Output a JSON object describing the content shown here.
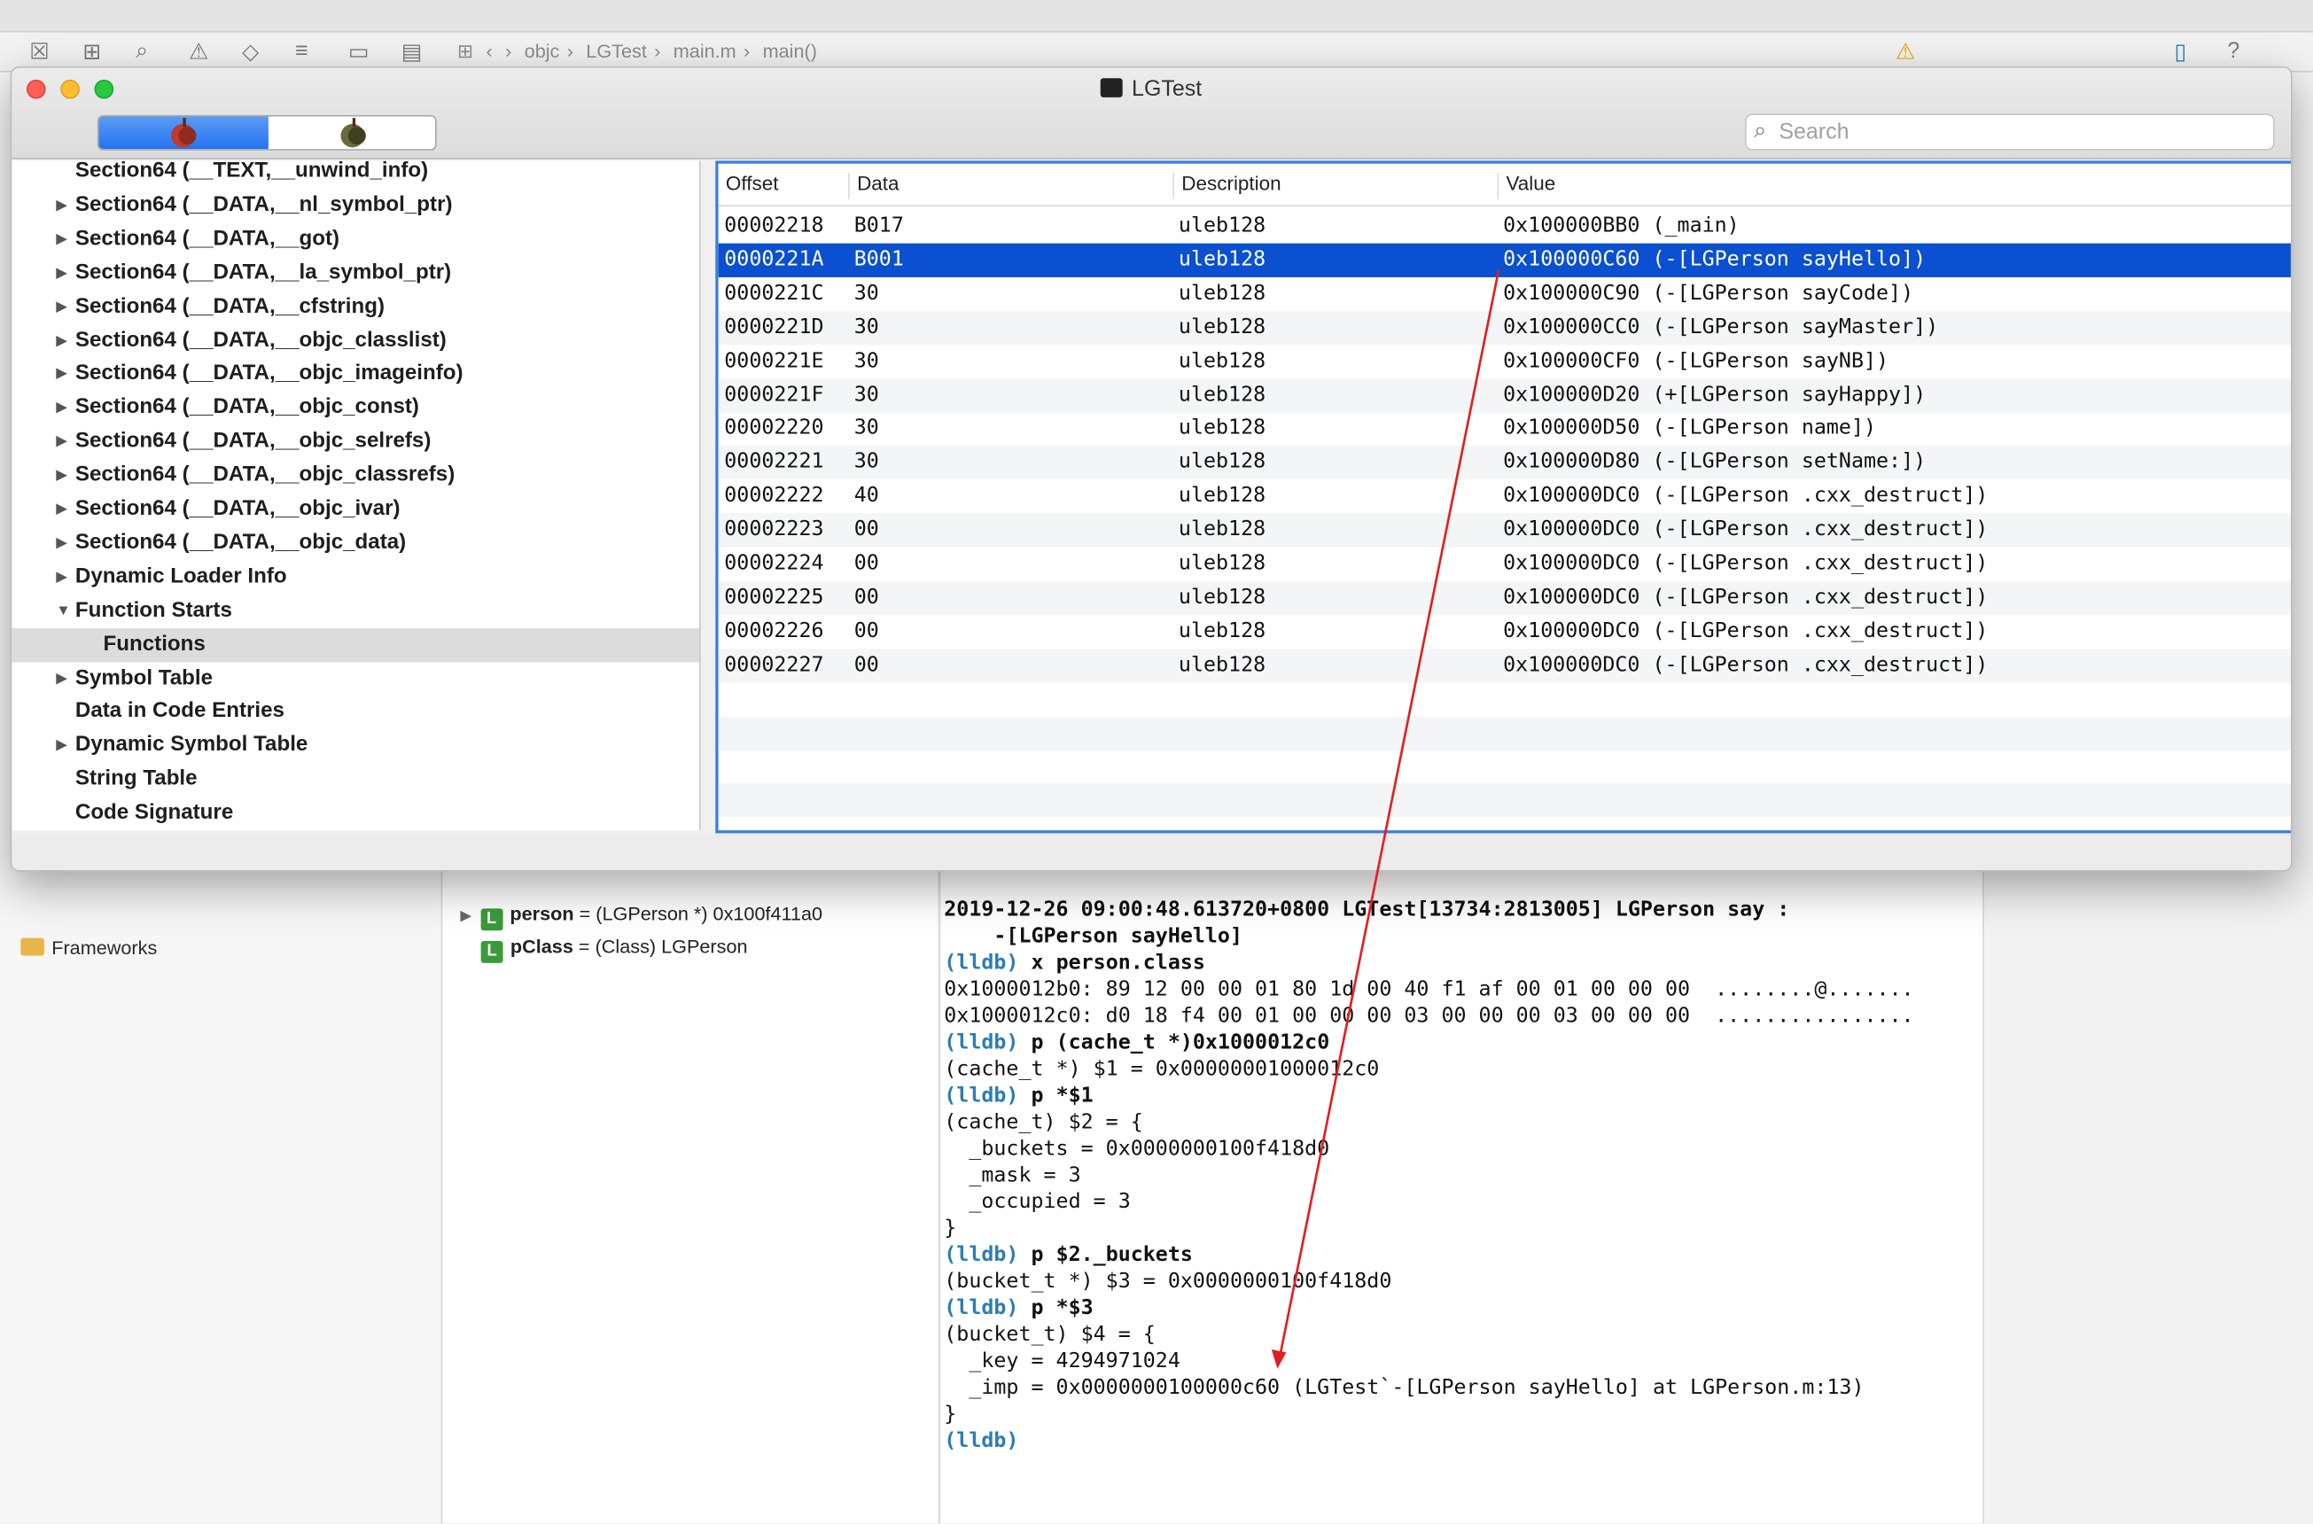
{
  "xcode": {
    "breadcrumb": [
      "objc",
      "LGTest",
      "main.m",
      "main()"
    ],
    "sidebar_item": "Frameworks",
    "variables": [
      {
        "name": "person",
        "value": "= (LGPerson *) 0x100f411a0"
      },
      {
        "name": "pClass",
        "value": "= (Class) LGPerson"
      }
    ],
    "console": [
      {
        "t": "bold",
        "s": "2019-12-26 09:00:48.613720+0800 LGTest[13734:2813005] LGPerson say :"
      },
      {
        "t": "bold",
        "s": "    -[LGPerson sayHello]"
      },
      {
        "t": "cmd",
        "p": "(lldb) ",
        "s": "x person.class"
      },
      {
        "t": "out",
        "s": "0x1000012b0: 89 12 00 00 01 80 1d 00 40 f1 af 00 01 00 00 00  ........@......."
      },
      {
        "t": "out",
        "s": "0x1000012c0: d0 18 f4 00 01 00 00 00 03 00 00 00 03 00 00 00  ................"
      },
      {
        "t": "cmd",
        "p": "(lldb) ",
        "s": "p (cache_t *)0x1000012c0"
      },
      {
        "t": "out",
        "s": "(cache_t *) $1 = 0x00000001000012c0"
      },
      {
        "t": "cmd",
        "p": "(lldb) ",
        "s": "p *$1"
      },
      {
        "t": "out",
        "s": "(cache_t) $2 = {"
      },
      {
        "t": "out",
        "s": "  _buckets = 0x0000000100f418d0"
      },
      {
        "t": "out",
        "s": "  _mask = 3"
      },
      {
        "t": "out",
        "s": "  _occupied = 3"
      },
      {
        "t": "out",
        "s": "}"
      },
      {
        "t": "cmd",
        "p": "(lldb) ",
        "s": "p $2._buckets"
      },
      {
        "t": "out",
        "s": "(bucket_t *) $3 = 0x0000000100f418d0"
      },
      {
        "t": "cmd",
        "p": "(lldb) ",
        "s": "p *$3"
      },
      {
        "t": "out",
        "s": "(bucket_t) $4 = {"
      },
      {
        "t": "out",
        "s": "  _key = 4294971024"
      },
      {
        "t": "out",
        "s": "  _imp = 0x0000000100000c60 (LGTest`-[LGPerson sayHello] at LGPerson.m:13)"
      },
      {
        "t": "out",
        "s": "}"
      },
      {
        "t": "cmd",
        "p": "(lldb) ",
        "s": ""
      }
    ]
  },
  "window": {
    "title": "LGTest",
    "search_placeholder": "Search",
    "columns": [
      "Offset",
      "Data",
      "Description",
      "Value"
    ],
    "tree": [
      {
        "label": "Section64 (__TEXT,__unwind_info)",
        "tri": "",
        "indent": 0
      },
      {
        "label": "Section64 (__DATA,__nl_symbol_ptr)",
        "tri": "▶",
        "indent": 0
      },
      {
        "label": "Section64 (__DATA,__got)",
        "tri": "▶",
        "indent": 0
      },
      {
        "label": "Section64 (__DATA,__la_symbol_ptr)",
        "tri": "▶",
        "indent": 0
      },
      {
        "label": "Section64 (__DATA,__cfstring)",
        "tri": "▶",
        "indent": 0
      },
      {
        "label": "Section64 (__DATA,__objc_classlist)",
        "tri": "▶",
        "indent": 0
      },
      {
        "label": "Section64 (__DATA,__objc_imageinfo)",
        "tri": "▶",
        "indent": 0
      },
      {
        "label": "Section64 (__DATA,__objc_const)",
        "tri": "▶",
        "indent": 0
      },
      {
        "label": "Section64 (__DATA,__objc_selrefs)",
        "tri": "▶",
        "indent": 0
      },
      {
        "label": "Section64 (__DATA,__objc_classrefs)",
        "tri": "▶",
        "indent": 0
      },
      {
        "label": "Section64 (__DATA,__objc_ivar)",
        "tri": "▶",
        "indent": 0
      },
      {
        "label": "Section64 (__DATA,__objc_data)",
        "tri": "▶",
        "indent": 0
      },
      {
        "label": "Dynamic Loader Info",
        "tri": "▶",
        "indent": 0
      },
      {
        "label": "Function Starts",
        "tri": "▼",
        "indent": 0
      },
      {
        "label": "Functions",
        "tri": "",
        "indent": 1,
        "selected": true
      },
      {
        "label": "Symbol Table",
        "tri": "▶",
        "indent": 0
      },
      {
        "label": "Data in Code Entries",
        "tri": "",
        "indent": 0
      },
      {
        "label": "Dynamic Symbol Table",
        "tri": "▶",
        "indent": 0
      },
      {
        "label": "String Table",
        "tri": "",
        "indent": 0
      },
      {
        "label": "Code Signature",
        "tri": "",
        "indent": 0
      }
    ],
    "rows": [
      {
        "offset": "00002218",
        "data": "B017",
        "desc": "uleb128",
        "value": "0x100000BB0 (_main)"
      },
      {
        "offset": "0000221A",
        "data": "B001",
        "desc": "uleb128",
        "value": "0x100000C60 (-[LGPerson sayHello])",
        "selected": true
      },
      {
        "offset": "0000221C",
        "data": "30",
        "desc": "uleb128",
        "value": "0x100000C90 (-[LGPerson sayCode])"
      },
      {
        "offset": "0000221D",
        "data": "30",
        "desc": "uleb128",
        "value": "0x100000CC0 (-[LGPerson sayMaster])"
      },
      {
        "offset": "0000221E",
        "data": "30",
        "desc": "uleb128",
        "value": "0x100000CF0 (-[LGPerson sayNB])"
      },
      {
        "offset": "0000221F",
        "data": "30",
        "desc": "uleb128",
        "value": "0x100000D20 (+[LGPerson sayHappy])"
      },
      {
        "offset": "00002220",
        "data": "30",
        "desc": "uleb128",
        "value": "0x100000D50 (-[LGPerson name])"
      },
      {
        "offset": "00002221",
        "data": "30",
        "desc": "uleb128",
        "value": "0x100000D80 (-[LGPerson setName:])"
      },
      {
        "offset": "00002222",
        "data": "40",
        "desc": "uleb128",
        "value": "0x100000DC0 (-[LGPerson .cxx_destruct])"
      },
      {
        "offset": "00002223",
        "data": "00",
        "desc": "uleb128",
        "value": "0x100000DC0 (-[LGPerson .cxx_destruct])"
      },
      {
        "offset": "00002224",
        "data": "00",
        "desc": "uleb128",
        "value": "0x100000DC0 (-[LGPerson .cxx_destruct])"
      },
      {
        "offset": "00002225",
        "data": "00",
        "desc": "uleb128",
        "value": "0x100000DC0 (-[LGPerson .cxx_destruct])"
      },
      {
        "offset": "00002226",
        "data": "00",
        "desc": "uleb128",
        "value": "0x100000DC0 (-[LGPerson .cxx_destruct])"
      },
      {
        "offset": "00002227",
        "data": "00",
        "desc": "uleb128",
        "value": "0x100000DC0 (-[LGPerson .cxx_destruct])"
      }
    ],
    "colors": {
      "selection": "#0b50d0",
      "focus_ring": "#3d7ce0",
      "arrow": "#e02020",
      "lldb_prompt": "#2a7db6"
    }
  }
}
